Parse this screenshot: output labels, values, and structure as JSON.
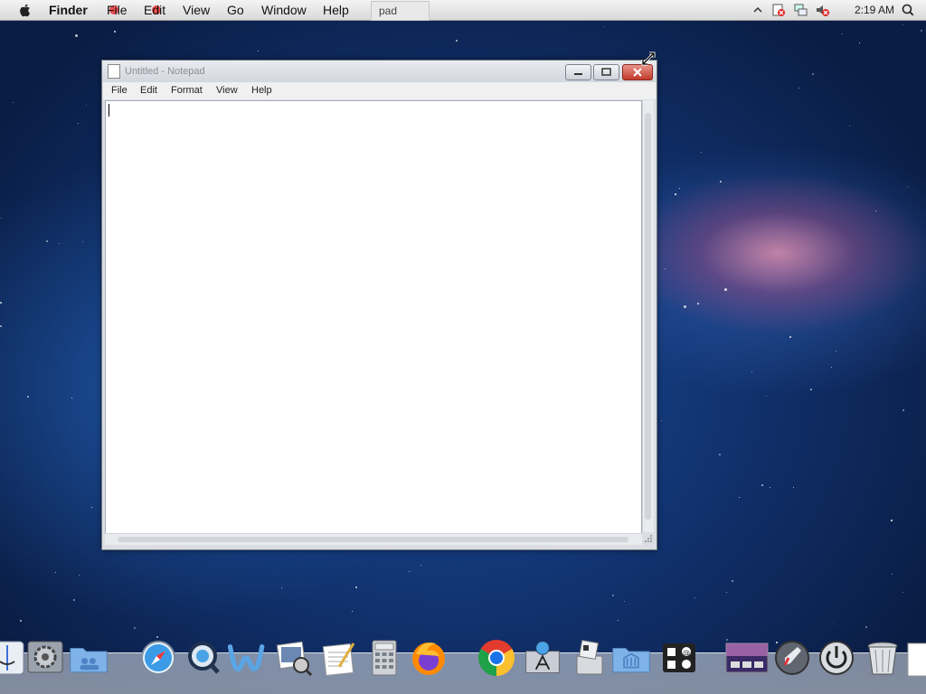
{
  "menubar": {
    "app_name": "Finder",
    "menus": [
      "File",
      "Edit",
      "View",
      "Go",
      "Window",
      "Help"
    ],
    "ghost_window_label": "pad",
    "clock": "2:19 AM"
  },
  "notepad": {
    "title": "Untitled - Notepad",
    "menus": [
      "File",
      "Edit",
      "Format",
      "View",
      "Help"
    ],
    "content": ""
  },
  "dock": {
    "items": [
      "finder-icon",
      "system-preferences-icon",
      "users-folder-icon",
      "safari-icon",
      "quicktime-icon",
      "word-icon",
      "iphoto-icon",
      "textedit-icon",
      "calculator-icon",
      "firefox-icon",
      "chrome-icon",
      "app-store-icon",
      "disk-utility-icon",
      "applications-folder-icon",
      "dashboard-icon",
      "mission-control-icon",
      "launchpad-icon",
      "shutdown-icon",
      "trash-icon",
      "document-icon"
    ]
  },
  "colors": {
    "desktop_bg": "#123574",
    "menubar_bg": "#e6e6e6",
    "close_button": "#c23a2c",
    "window_chrome": "#dadde2"
  }
}
